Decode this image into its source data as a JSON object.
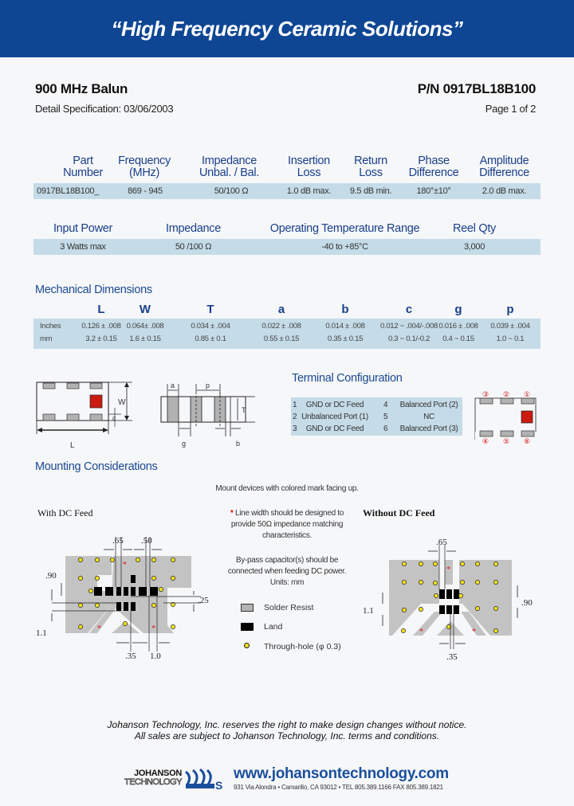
{
  "banner": {
    "title": "“High Frequency Ceramic Solutions”"
  },
  "header": {
    "product": "900 MHz Balun",
    "part_number": "P/N 0917BL18B100",
    "spec": "Detail Specification: 03/06/2003",
    "page": "Page 1 of 2"
  },
  "spec_table": {
    "headers": [
      [
        "Part",
        "Number"
      ],
      [
        "Frequency",
        "(MHz)"
      ],
      [
        "Impedance",
        "Unbal. / Bal."
      ],
      [
        "Insertion",
        "Loss"
      ],
      [
        "Return",
        "Loss"
      ],
      [
        "Phase",
        "Difference"
      ],
      [
        "Amplitude",
        "Difference"
      ]
    ],
    "row": [
      "0917BL18B100_",
      "869 - 945",
      "50/100 Ω",
      "1.0 dB max.",
      "9.5 dB min.",
      "180°±10°",
      "2.0 dB max."
    ]
  },
  "power_table": {
    "headers": [
      "Input Power",
      "Impedance",
      "Operating Temperature Range",
      "Reel Qty"
    ],
    "row": [
      "3 Watts max",
      "50 /100 Ω",
      "-40 to +85°C",
      "3,000"
    ]
  },
  "mechanical": {
    "title": "Mechanical Dimensions",
    "columns": [
      "L",
      "W",
      "T",
      "a",
      "b",
      "c",
      "g",
      "p"
    ],
    "rows": [
      {
        "unit": "Inches",
        "values": [
          "0.126 ± .008",
          "0.064± .008",
          "0.034 ± .004",
          "0.022 ± .008",
          "0.014 ± .008",
          "0.012 ~ .004/-.008",
          "0.016 ± .008",
          "0.039 ± .004"
        ]
      },
      {
        "unit": "mm",
        "values": [
          "3.2 ± 0.15",
          "1.6 ± 0.15",
          "0.85 ± 0.1",
          "0.55 ± 0.15",
          "0.35 ± 0.15",
          "0.3 ~ 0.1/-0.2",
          "0.4 ~ 0.15",
          "1.0 ~ 0.1"
        ]
      }
    ],
    "diagram_labels": {
      "L": "L",
      "W": "W",
      "c": "c",
      "a": "a",
      "p": "p",
      "T": "T",
      "g": "g",
      "b": "b"
    }
  },
  "terminal": {
    "title": "Terminal Configuration",
    "rows": [
      {
        "n1": "1",
        "l1": "GND or DC Feed",
        "n2": "4",
        "l2": "Balanced Port (2)"
      },
      {
        "n1": "2",
        "l1": "Unbalanced Port (1)",
        "n2": "5",
        "l2": "NC"
      },
      {
        "n1": "3",
        "l1": "GND or DC Feed",
        "n2": "6",
        "l2": "Balanced Port (3)"
      }
    ],
    "pins_top": [
      "③",
      "②",
      "①"
    ],
    "pins_bottom": [
      "④",
      "⑤",
      "⑥"
    ]
  },
  "mounting": {
    "title": "Mounting Considerations",
    "instruction": "Mount devices with colored mark facing up.",
    "with_dc": "With DC Feed",
    "without_dc": "Without DC Feed",
    "note1_star": "*",
    "note1": [
      "Line width should be designed to",
      "provide 50Ω impedance matching",
      "characteristics."
    ],
    "note2": [
      "By-pass capacitor(s) should be",
      "connected when feeding DC power.",
      "Units: mm"
    ],
    "legend": [
      "Solder Resist",
      "Land",
      "Through-hole (φ 0.3)"
    ],
    "dims_with": {
      "d65": ".65",
      "d50": ".50",
      "d90": ".90",
      "d25": ".25",
      "d11": "1.1",
      "d35": ".35",
      "d10": "1.0"
    },
    "dims_without": {
      "d65": ".65",
      "d90": ".90",
      "d11": "1.1",
      "d35": ".35"
    }
  },
  "footer": {
    "line1": "Johanson Technology, Inc. reserves the right to make design changes without notice.",
    "line2": "All sales are subject to Johanson Technology, Inc. terms and conditions.",
    "logo_top": "JOHANSON",
    "logo_bottom": "TECHNOLOGY",
    "url": "www.johansontechnology.com",
    "address": "931 Via Alondra • Camarillo, CA 93012 • TEL 805.389.1166  FAX 805.389.1821"
  },
  "colors": {
    "brand_blue": "#0e4694",
    "table_band": "#c5dbe8",
    "mark_red": "#cc1a10",
    "via_yellow": "#f2e21a"
  }
}
